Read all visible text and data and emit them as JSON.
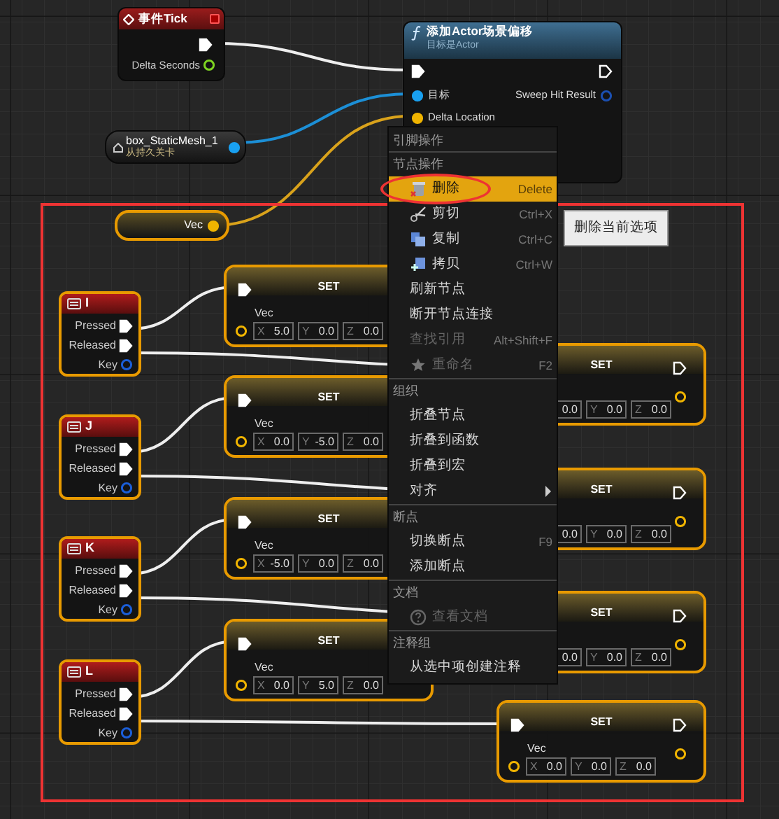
{
  "event_tick": {
    "title": "事件Tick",
    "output": "Delta Seconds",
    "selected": false
  },
  "function_node": {
    "title": "添加Actor场景偏移",
    "subtitle": "目标是Actor",
    "inputs": [
      "目标",
      "Delta Location"
    ],
    "outputs": [
      "Sweep Hit Result"
    ],
    "selected": false
  },
  "reference_node": {
    "name": "box_StaticMesh_1",
    "subtitle": "从持久关卡",
    "selected": false
  },
  "variable_node": {
    "name": "Vec",
    "selected": true
  },
  "key_events": [
    {
      "key": "I",
      "selected": true,
      "pins": [
        {
          "label": "Pressed",
          "kind": "exec"
        },
        {
          "label": "Released",
          "kind": "exec"
        },
        {
          "label": "Key",
          "kind": "key"
        }
      ]
    },
    {
      "key": "J",
      "selected": true,
      "pins": [
        {
          "label": "Pressed",
          "kind": "exec"
        },
        {
          "label": "Released",
          "kind": "exec"
        },
        {
          "label": "Key",
          "kind": "key"
        }
      ]
    },
    {
      "key": "K",
      "selected": true,
      "pins": [
        {
          "label": "Pressed",
          "kind": "exec"
        },
        {
          "label": "Released",
          "kind": "exec"
        },
        {
          "label": "Key",
          "kind": "key"
        }
      ]
    },
    {
      "key": "L",
      "selected": true,
      "pins": [
        {
          "label": "Pressed",
          "kind": "exec"
        },
        {
          "label": "Released",
          "kind": "exec"
        },
        {
          "label": "Key",
          "kind": "key"
        }
      ]
    }
  ],
  "set_nodes_pressed": [
    {
      "title": "SET",
      "variable": "Vec",
      "selected": true,
      "fields": [
        {
          "label": "X",
          "value": "5.0"
        },
        {
          "label": "Y",
          "value": "0.0"
        },
        {
          "label": "Z",
          "value": "0.0"
        }
      ]
    },
    {
      "title": "SET",
      "variable": "Vec",
      "selected": true,
      "fields": [
        {
          "label": "X",
          "value": "0.0"
        },
        {
          "label": "Y",
          "value": "-5.0"
        },
        {
          "label": "Z",
          "value": "0.0"
        }
      ]
    },
    {
      "title": "SET",
      "variable": "Vec",
      "selected": true,
      "fields": [
        {
          "label": "X",
          "value": "-5.0"
        },
        {
          "label": "Y",
          "value": "0.0"
        },
        {
          "label": "Z",
          "value": "0.0"
        }
      ]
    },
    {
      "title": "SET",
      "variable": "Vec",
      "selected": true,
      "fields": [
        {
          "label": "X",
          "value": "0.0"
        },
        {
          "label": "Y",
          "value": "5.0"
        },
        {
          "label": "Z",
          "value": "0.0"
        }
      ]
    }
  ],
  "set_nodes_released": [
    {
      "title": "SET",
      "selected": true,
      "fields": [
        {
          "value": "0.0"
        },
        {
          "label": "Y",
          "value": "0.0"
        },
        {
          "label": "Z",
          "value": "0.0"
        }
      ]
    },
    {
      "title": "SET",
      "selected": true,
      "fields": [
        {
          "value": "0.0"
        },
        {
          "label": "Y",
          "value": "0.0"
        },
        {
          "label": "Z",
          "value": "0.0"
        }
      ]
    },
    {
      "title": "SET",
      "selected": true,
      "fields": [
        {
          "value": "0.0"
        },
        {
          "label": "Y",
          "value": "0.0"
        },
        {
          "label": "Z",
          "value": "0.0"
        }
      ]
    },
    {
      "title": "SET",
      "variable": "Vec",
      "selected": true,
      "fields": [
        {
          "label": "X",
          "value": "0.0"
        },
        {
          "label": "Y",
          "value": "0.0"
        },
        {
          "label": "Z",
          "value": "0.0"
        }
      ]
    }
  ],
  "context_menu": {
    "items": [
      {
        "kind": "section",
        "label": "引脚操作"
      },
      {
        "kind": "section",
        "label": "节点操作"
      },
      {
        "kind": "delete",
        "label": "删除",
        "shortcut": "Delete",
        "selected": true,
        "disabled": false
      },
      {
        "kind": "cut",
        "label": "剪切",
        "shortcut": "Ctrl+X",
        "selected": false,
        "disabled": false
      },
      {
        "kind": "copy",
        "label": "复制",
        "shortcut": "Ctrl+C",
        "selected": false,
        "disabled": false
      },
      {
        "kind": "duplicate",
        "label": "拷贝",
        "shortcut": "Ctrl+W",
        "selected": false,
        "disabled": false
      },
      {
        "kind": "item",
        "label": "刷新节点",
        "selected": false,
        "disabled": false
      },
      {
        "kind": "item",
        "label": "断开节点连接",
        "selected": false,
        "disabled": false
      },
      {
        "kind": "item",
        "label": "查找引用",
        "shortcut": "Alt+Shift+F",
        "selected": false,
        "disabled": true
      },
      {
        "kind": "rename",
        "label": "重命名",
        "shortcut": "F2",
        "selected": false,
        "disabled": true
      },
      {
        "kind": "section",
        "label": "组织"
      },
      {
        "kind": "item",
        "label": "折叠节点",
        "selected": false,
        "disabled": false
      },
      {
        "kind": "item",
        "label": "折叠到函数",
        "selected": false,
        "disabled": false
      },
      {
        "kind": "item",
        "label": "折叠到宏",
        "selected": false,
        "disabled": false
      },
      {
        "kind": "item",
        "label": "对齐",
        "submenu": true,
        "selected": false,
        "disabled": false
      },
      {
        "kind": "section",
        "label": "断点"
      },
      {
        "kind": "item",
        "label": "切换断点",
        "shortcut": "F9",
        "selected": false,
        "disabled": false
      },
      {
        "kind": "item",
        "label": "添加断点",
        "selected": false,
        "disabled": false
      },
      {
        "kind": "section",
        "label": "文档"
      },
      {
        "kind": "docs",
        "label": "查看文档",
        "selected": false,
        "disabled": true
      },
      {
        "kind": "section",
        "label": "注释组"
      },
      {
        "kind": "item",
        "label": "从选中项创建注释",
        "selected": false,
        "disabled": false
      }
    ]
  },
  "tooltip": "删除当前选项"
}
